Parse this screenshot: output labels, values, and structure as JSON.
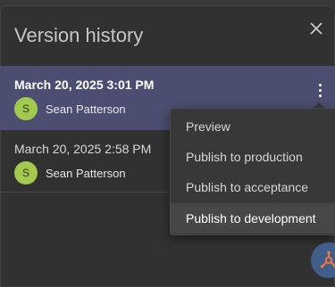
{
  "panel": {
    "title": "Version history",
    "close_icon": "close-icon"
  },
  "versions": [
    {
      "date": "March 20, 2025 3:01 PM",
      "author": "Sean Patterson",
      "avatar_initial": "S",
      "selected": true
    },
    {
      "date": "March 20, 2025 2:58 PM",
      "author": "Sean Patterson",
      "avatar_initial": "S",
      "selected": false
    }
  ],
  "context_menu": {
    "items": [
      {
        "label": "Preview"
      },
      {
        "label": "Publish to production"
      },
      {
        "label": "Publish to acceptance"
      },
      {
        "label": "Publish to development",
        "highlighted": true
      }
    ]
  },
  "colors": {
    "selected_row": "#4b4e70",
    "avatar": "#a3c94e",
    "fab": "#3f5f8a",
    "fab_icon": "#f0743e"
  }
}
